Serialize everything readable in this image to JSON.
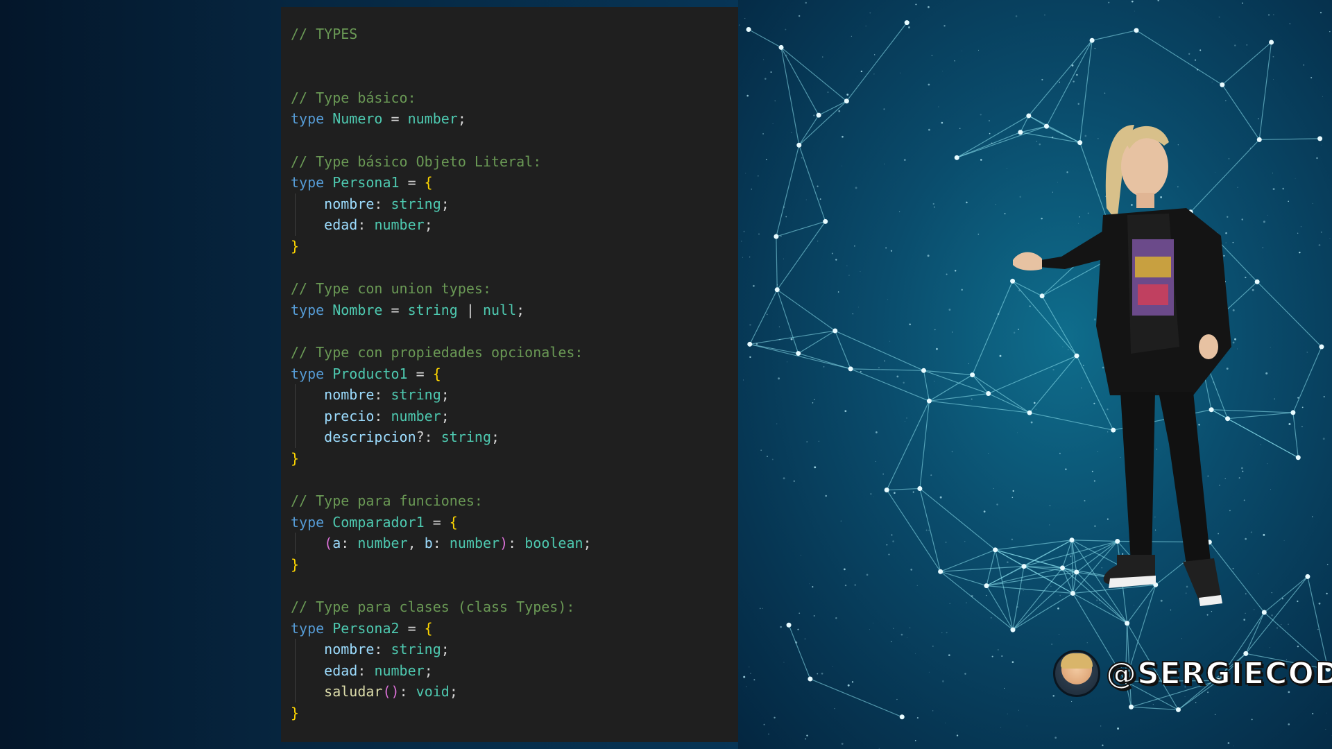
{
  "code": {
    "lines": [
      [
        {
          "cls": "c-comment",
          "t": "// TYPES"
        }
      ],
      [],
      [],
      [
        {
          "cls": "c-comment",
          "t": "// Type básico:"
        }
      ],
      [
        {
          "cls": "c-kw",
          "t": "type "
        },
        {
          "cls": "c-type",
          "t": "Numero"
        },
        {
          "cls": "c-punc",
          "t": " = "
        },
        {
          "cls": "c-type",
          "t": "number"
        },
        {
          "cls": "c-punc",
          "t": ";"
        }
      ],
      [],
      [
        {
          "cls": "c-comment",
          "t": "// Type básico Objeto Literal:"
        }
      ],
      [
        {
          "cls": "c-kw",
          "t": "type "
        },
        {
          "cls": "c-type",
          "t": "Persona1"
        },
        {
          "cls": "c-punc",
          "t": " = "
        },
        {
          "cls": "c-brace",
          "t": "{"
        }
      ],
      [
        {
          "cls": "c-punc",
          "t": "    "
        },
        {
          "cls": "c-prop",
          "t": "nombre"
        },
        {
          "cls": "c-punc",
          "t": ": "
        },
        {
          "cls": "c-type",
          "t": "string"
        },
        {
          "cls": "c-punc",
          "t": ";"
        }
      ],
      [
        {
          "cls": "c-punc",
          "t": "    "
        },
        {
          "cls": "c-prop",
          "t": "edad"
        },
        {
          "cls": "c-punc",
          "t": ": "
        },
        {
          "cls": "c-type",
          "t": "number"
        },
        {
          "cls": "c-punc",
          "t": ";"
        }
      ],
      [
        {
          "cls": "c-brace",
          "t": "}"
        }
      ],
      [],
      [
        {
          "cls": "c-comment",
          "t": "// Type con union types:"
        }
      ],
      [
        {
          "cls": "c-kw",
          "t": "type "
        },
        {
          "cls": "c-type",
          "t": "Nombre"
        },
        {
          "cls": "c-punc",
          "t": " = "
        },
        {
          "cls": "c-type",
          "t": "string"
        },
        {
          "cls": "c-punc",
          "t": " | "
        },
        {
          "cls": "c-type",
          "t": "null"
        },
        {
          "cls": "c-punc",
          "t": ";"
        }
      ],
      [],
      [
        {
          "cls": "c-comment",
          "t": "// Type con propiedades opcionales:"
        }
      ],
      [
        {
          "cls": "c-kw",
          "t": "type "
        },
        {
          "cls": "c-type",
          "t": "Producto1"
        },
        {
          "cls": "c-punc",
          "t": " = "
        },
        {
          "cls": "c-brace",
          "t": "{"
        }
      ],
      [
        {
          "cls": "c-punc",
          "t": "    "
        },
        {
          "cls": "c-prop",
          "t": "nombre"
        },
        {
          "cls": "c-punc",
          "t": ": "
        },
        {
          "cls": "c-type",
          "t": "string"
        },
        {
          "cls": "c-punc",
          "t": ";"
        }
      ],
      [
        {
          "cls": "c-punc",
          "t": "    "
        },
        {
          "cls": "c-prop",
          "t": "precio"
        },
        {
          "cls": "c-punc",
          "t": ": "
        },
        {
          "cls": "c-type",
          "t": "number"
        },
        {
          "cls": "c-punc",
          "t": ";"
        }
      ],
      [
        {
          "cls": "c-punc",
          "t": "    "
        },
        {
          "cls": "c-prop",
          "t": "descripcion"
        },
        {
          "cls": "c-punc",
          "t": "?: "
        },
        {
          "cls": "c-type",
          "t": "string"
        },
        {
          "cls": "c-punc",
          "t": ";"
        }
      ],
      [
        {
          "cls": "c-brace",
          "t": "}"
        }
      ],
      [],
      [
        {
          "cls": "c-comment",
          "t": "// Type para funciones:"
        }
      ],
      [
        {
          "cls": "c-kw",
          "t": "type "
        },
        {
          "cls": "c-type",
          "t": "Comparador1"
        },
        {
          "cls": "c-punc",
          "t": " = "
        },
        {
          "cls": "c-brace",
          "t": "{"
        }
      ],
      [
        {
          "cls": "c-punc",
          "t": "    "
        },
        {
          "cls": "c-paren",
          "t": "("
        },
        {
          "cls": "c-prop",
          "t": "a"
        },
        {
          "cls": "c-punc",
          "t": ": "
        },
        {
          "cls": "c-type",
          "t": "number"
        },
        {
          "cls": "c-punc",
          "t": ", "
        },
        {
          "cls": "c-prop",
          "t": "b"
        },
        {
          "cls": "c-punc",
          "t": ": "
        },
        {
          "cls": "c-type",
          "t": "number"
        },
        {
          "cls": "c-paren",
          "t": ")"
        },
        {
          "cls": "c-punc",
          "t": ": "
        },
        {
          "cls": "c-type",
          "t": "boolean"
        },
        {
          "cls": "c-punc",
          "t": ";"
        }
      ],
      [
        {
          "cls": "c-brace",
          "t": "}"
        }
      ],
      [],
      [
        {
          "cls": "c-comment",
          "t": "// Type para clases (class Types):"
        }
      ],
      [
        {
          "cls": "c-kw",
          "t": "type "
        },
        {
          "cls": "c-type",
          "t": "Persona2"
        },
        {
          "cls": "c-punc",
          "t": " = "
        },
        {
          "cls": "c-brace",
          "t": "{"
        }
      ],
      [
        {
          "cls": "c-punc",
          "t": "    "
        },
        {
          "cls": "c-prop",
          "t": "nombre"
        },
        {
          "cls": "c-punc",
          "t": ": "
        },
        {
          "cls": "c-type",
          "t": "string"
        },
        {
          "cls": "c-punc",
          "t": ";"
        }
      ],
      [
        {
          "cls": "c-punc",
          "t": "    "
        },
        {
          "cls": "c-prop",
          "t": "edad"
        },
        {
          "cls": "c-punc",
          "t": ": "
        },
        {
          "cls": "c-type",
          "t": "number"
        },
        {
          "cls": "c-punc",
          "t": ";"
        }
      ],
      [
        {
          "cls": "c-punc",
          "t": "    "
        },
        {
          "cls": "c-fn",
          "t": "saludar"
        },
        {
          "cls": "c-paren",
          "t": "()"
        },
        {
          "cls": "c-punc",
          "t": ": "
        },
        {
          "cls": "c-type",
          "t": "void"
        },
        {
          "cls": "c-punc",
          "t": ";"
        }
      ],
      [
        {
          "cls": "c-brace",
          "t": "}"
        }
      ]
    ],
    "indented_lines": [
      8,
      9,
      17,
      18,
      19,
      24,
      29,
      30,
      31
    ]
  },
  "brand": {
    "handle": "@SERGIECODE"
  },
  "colors": {
    "code_bg": "#1f1f1f",
    "comment": "#6a9955",
    "keyword": "#569cd6",
    "type": "#4ec9b0",
    "property": "#9cdcfe",
    "function": "#dcdcaa",
    "brace": "#ffd700",
    "paren": "#da70d6",
    "network_line": "#8fe6f2"
  }
}
